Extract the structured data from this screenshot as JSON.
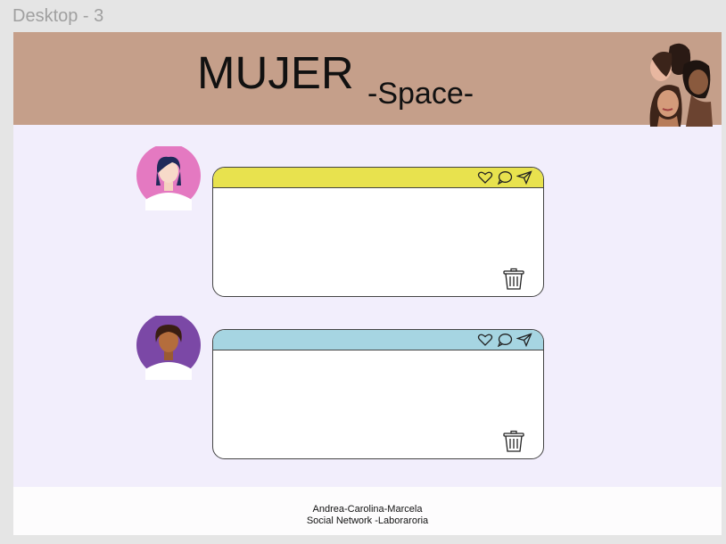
{
  "frame": {
    "label": "Desktop - 3"
  },
  "header": {
    "title": "MUJER",
    "subtitle": "-Space-"
  },
  "posts": [
    {
      "bar_color": "#e8e24e",
      "avatar": "woman-avatar-pink"
    },
    {
      "bar_color": "#a6d5e2",
      "avatar": "woman-avatar-purple"
    }
  ],
  "footer": {
    "line1": "Andrea-Carolina-Marcela",
    "line2": "Social Network -Laboraroria"
  },
  "colors": {
    "header_bg": "#c59f8a",
    "page_bg": "#f2eefc"
  }
}
